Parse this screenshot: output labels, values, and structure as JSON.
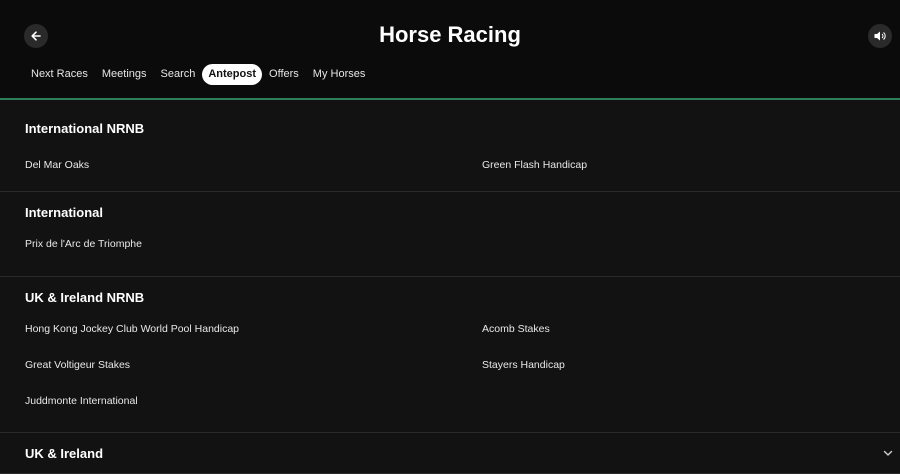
{
  "header": {
    "title": "Horse Racing"
  },
  "tabs": [
    {
      "label": "Next Races",
      "active": false
    },
    {
      "label": "Meetings",
      "active": false
    },
    {
      "label": "Search",
      "active": false
    },
    {
      "label": "Antepost",
      "active": true
    },
    {
      "label": "Offers",
      "active": false
    },
    {
      "label": "My Horses",
      "active": false
    }
  ],
  "sections": [
    {
      "title": "International NRNB",
      "races": [
        "Del Mar Oaks",
        "Green Flash Handicap"
      ]
    },
    {
      "title": "International",
      "races": [
        "Prix de l'Arc de Triomphe"
      ]
    },
    {
      "title": "UK & Ireland NRNB",
      "races": [
        "Hong Kong Jockey Club World Pool Handicap",
        "Acomb Stakes",
        "Great Voltigeur Stakes",
        "Stayers Handicap",
        "Juddmonte International"
      ]
    },
    {
      "title": "UK & Ireland",
      "races": []
    }
  ],
  "colors": {
    "background": "#121212",
    "header_background": "#0b0b0b",
    "accent_line": "#2e7d5b"
  },
  "icons": {
    "back": "arrow-left-icon",
    "sound": "speaker-icon",
    "expand": "chevron-down-icon"
  }
}
